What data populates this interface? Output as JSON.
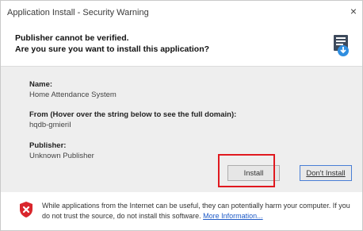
{
  "window": {
    "title": "Application Install - Security Warning",
    "close_glyph": "×"
  },
  "header": {
    "line1": "Publisher cannot be verified.",
    "line2": "Are you sure you want to install this application?",
    "icon": "application-install-icon"
  },
  "details": {
    "name_label": "Name:",
    "name_value": "Home Attendance System",
    "from_label": "From (Hover over the string below to see the full domain):",
    "from_value": "hqdb-gmieriI",
    "publisher_label": "Publisher:",
    "publisher_value": "Unknown Publisher"
  },
  "buttons": {
    "install": "Install",
    "dont_install": "Don't Install"
  },
  "footer": {
    "warning_text": "While applications from the Internet can be useful, they can potentially harm your computer. If you do not trust the source, do not install this software.",
    "more_info": "More Information..."
  },
  "colors": {
    "highlight": "#e0191f",
    "shield": "#d9262c",
    "link": "#1f5bc7"
  }
}
